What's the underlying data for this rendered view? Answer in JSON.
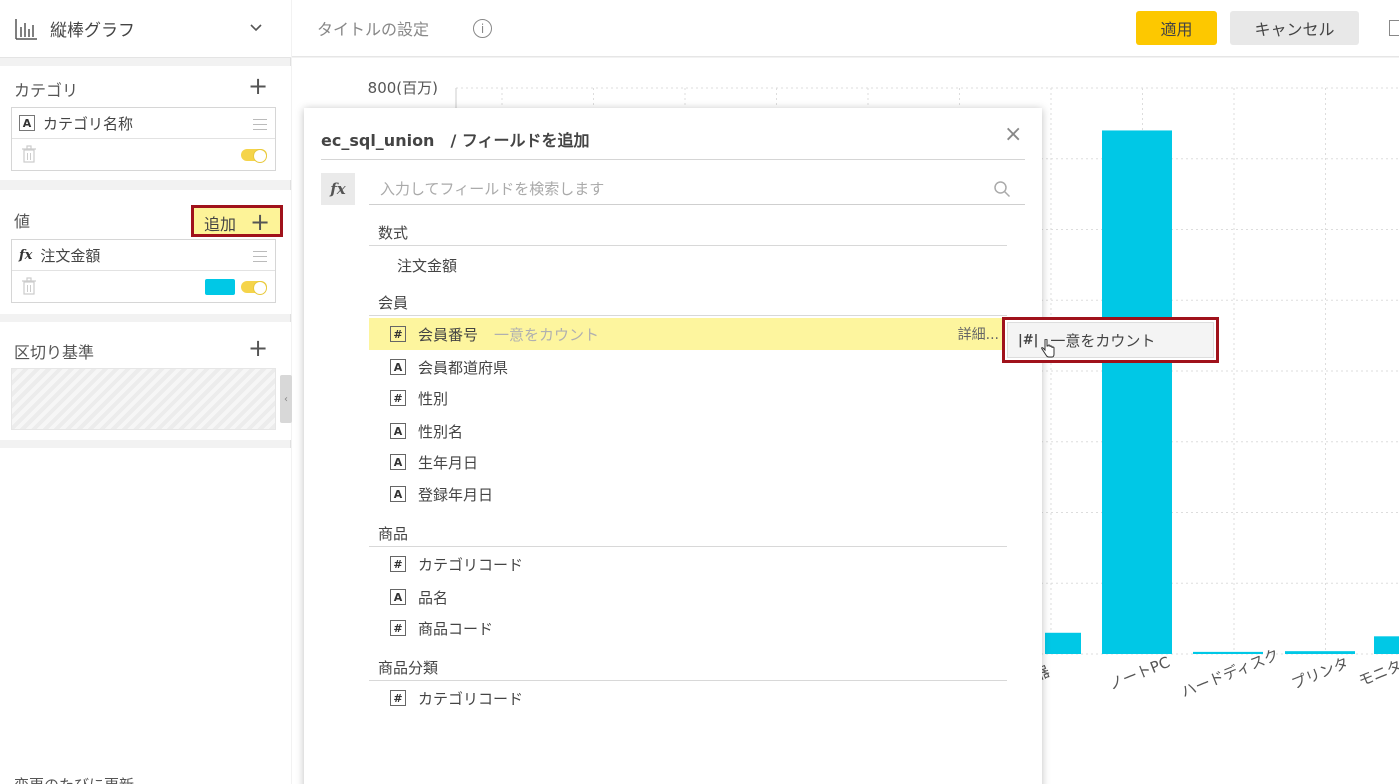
{
  "colors": {
    "accent": "#fdc800",
    "bar": "#00c8e6",
    "highlight": "#fdf59e",
    "callout": "#a0121b"
  },
  "left_panel": {
    "chart_type": {
      "label": "縦棒グラフ",
      "icon": "bar-chart-icon"
    },
    "category": {
      "title": "カテゴリ",
      "field": {
        "type": "A",
        "name": "カテゴリ名称"
      }
    },
    "value": {
      "title": "値",
      "add_label": "追加",
      "field": {
        "type": "fx",
        "name": "注文金額"
      }
    },
    "breakdown": {
      "title": "区切り基準"
    },
    "bottom_text": "変更のたびに更新"
  },
  "header": {
    "title": "タイトルの設定",
    "info": "i",
    "apply": "適用",
    "cancel": "キャンセル"
  },
  "chart_data": {
    "type": "bar",
    "ytick_label": "800(百万)",
    "categories": [
      "器",
      "ノートPC",
      "ハードディスク",
      "プリンタ",
      "モニタ"
    ],
    "values": [
      30,
      740,
      3,
      4,
      25
    ],
    "ylim": [
      0,
      800
    ],
    "grid": true
  },
  "dialog": {
    "title": "ec_sql_union　/ フィールドを追加",
    "close": "×",
    "fx": "fx",
    "search_placeholder": "入力してフィールドを検索します",
    "groups": [
      {
        "label": "数式"
      },
      {
        "label": "会員"
      },
      {
        "label": "商品"
      },
      {
        "label": "商品分類"
      }
    ],
    "formula_item": "注文金額",
    "member_items": [
      {
        "type": "#",
        "name": "会員番号",
        "aggregation": "一意をカウント",
        "detail": "詳細..."
      },
      {
        "type": "A",
        "name": "会員都道府県"
      },
      {
        "type": "#",
        "name": "性別"
      },
      {
        "type": "A",
        "name": "性別名"
      },
      {
        "type": "A",
        "name": "生年月日"
      },
      {
        "type": "A",
        "name": "登録年月日"
      }
    ],
    "product_items": [
      {
        "type": "#",
        "name": "カテゴリコード"
      },
      {
        "type": "A",
        "name": "品名"
      },
      {
        "type": "#",
        "name": "商品コード"
      }
    ],
    "category_items": [
      {
        "type": "#",
        "name": "カテゴリコード"
      }
    ]
  },
  "popup": {
    "icon": "|#|",
    "label": "一意をカウント"
  }
}
